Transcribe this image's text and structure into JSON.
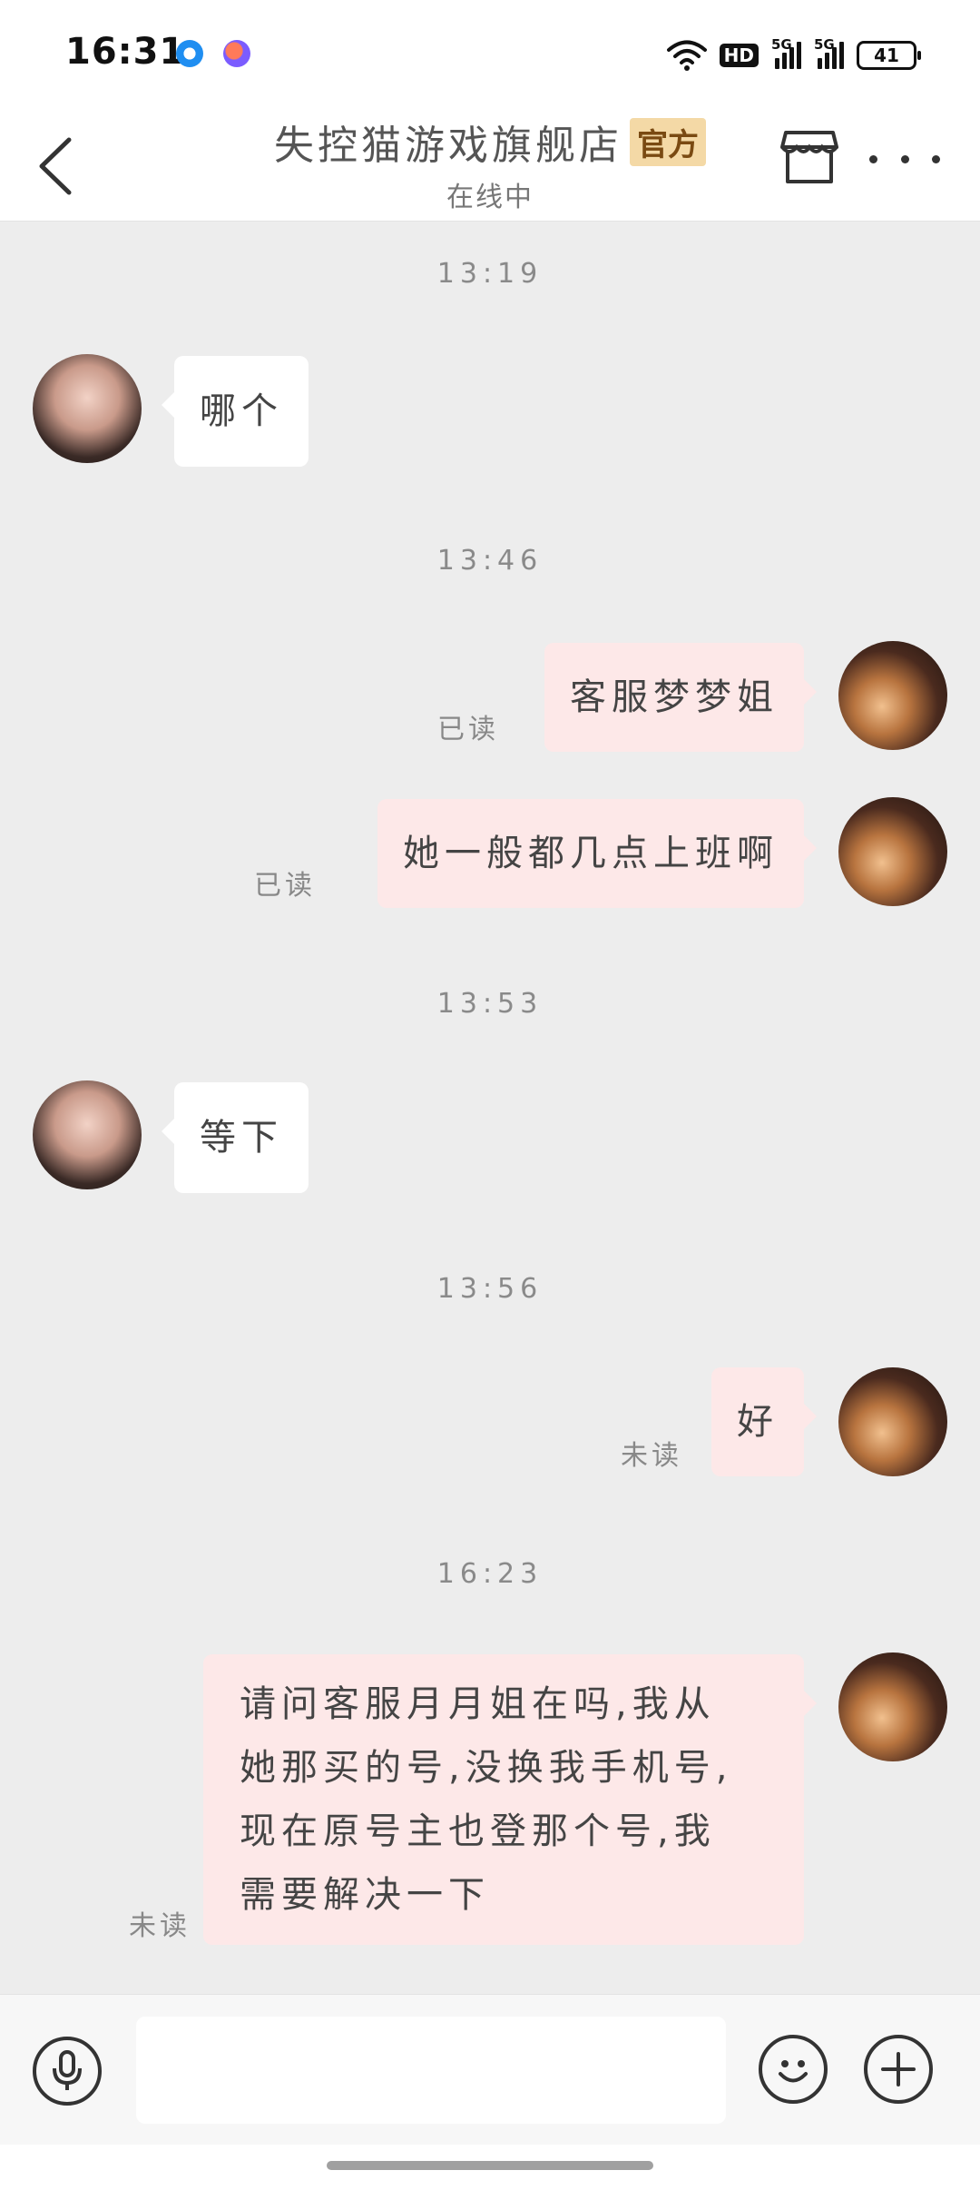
{
  "status_bar": {
    "time": "16:31",
    "hd_label": "HD",
    "network_1": "5G",
    "network_2": "5G",
    "battery": "41"
  },
  "header": {
    "shop_name": "失控猫游戏旗舰店",
    "official_badge": "官方",
    "online_status": "在线中"
  },
  "messages": [
    {
      "type": "time",
      "text": "13:19"
    },
    {
      "type": "incoming",
      "text": "哪个"
    },
    {
      "type": "time",
      "text": "13:46"
    },
    {
      "type": "outgoing",
      "text": "客服梦梦姐",
      "read": "已读"
    },
    {
      "type": "outgoing",
      "text": "她一般都几点上班啊",
      "read": "已读"
    },
    {
      "type": "time",
      "text": "13:53"
    },
    {
      "type": "incoming",
      "text": "等下"
    },
    {
      "type": "time",
      "text": "13:56"
    },
    {
      "type": "outgoing",
      "text": "好",
      "read": "未读"
    },
    {
      "type": "time",
      "text": "16:23"
    },
    {
      "type": "outgoing",
      "lines": [
        "请问客服月月姐在吗,我从",
        "她那买的号,没换我手机号,",
        "现在原号主也登那个号,我",
        "需要解决一下"
      ],
      "read": "未读"
    }
  ],
  "input_bar": {
    "voice_icon": "microphone-icon",
    "emoji_icon": "smiley-icon",
    "plus_icon": "plus-icon",
    "placeholder": ""
  }
}
